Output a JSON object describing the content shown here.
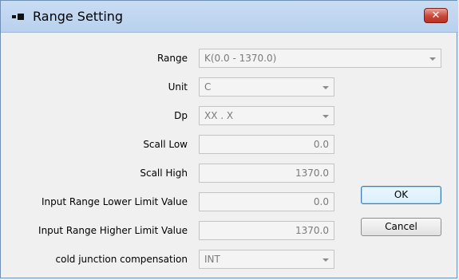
{
  "window": {
    "title": "Range Setting",
    "close_icon": "close-icon"
  },
  "form": {
    "range": {
      "label": "Range",
      "value": "K(0.0 - 1370.0)"
    },
    "unit": {
      "label": "Unit",
      "value": "C"
    },
    "dp": {
      "label": "Dp",
      "value": "XX . X"
    },
    "scall_low": {
      "label": "Scall Low",
      "value": "0.0"
    },
    "scall_high": {
      "label": "Scall High",
      "value": "1370.0"
    },
    "input_lower": {
      "label": "Input Range Lower Limit Value",
      "value": "0.0"
    },
    "input_higher": {
      "label": "Input Range Higher Limit Value",
      "value": "1370.0"
    },
    "cold_junction": {
      "label": "cold junction compensation",
      "value": "INT"
    }
  },
  "buttons": {
    "ok_label": "OK",
    "cancel_label": "Cancel"
  }
}
